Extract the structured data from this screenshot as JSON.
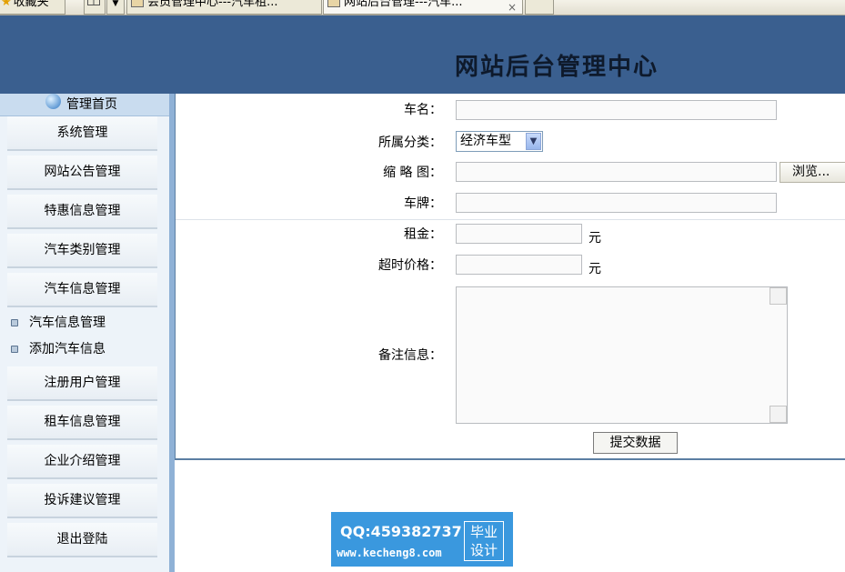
{
  "browser": {
    "favorites_label": "收藏夹",
    "tabs": [
      {
        "label": "会员管理中心---汽车租..."
      },
      {
        "label": "网站后台管理---汽车..."
      }
    ],
    "close_glyph": "×",
    "grid_icon": "grid-view-icon",
    "dropdown_icon": "chevron-down-icon"
  },
  "header": {
    "title": "网站后台管理中心",
    "bg_color": "#3a5f8f"
  },
  "sidebar": {
    "home_label": "管理首页",
    "items": [
      {
        "label": "系统管理"
      },
      {
        "label": "网站公告管理"
      },
      {
        "label": "特惠信息管理"
      },
      {
        "label": "汽车类别管理"
      },
      {
        "label": "汽车信息管理"
      }
    ],
    "sub_items": [
      {
        "label": "汽车信息管理"
      },
      {
        "label": "添加汽车信息"
      }
    ],
    "items_after": [
      {
        "label": "注册用户管理"
      },
      {
        "label": "租车信息管理"
      },
      {
        "label": "企业介绍管理"
      },
      {
        "label": "投诉建议管理"
      },
      {
        "label": "退出登陆"
      }
    ]
  },
  "form": {
    "car_name": {
      "label": "车名：",
      "value": ""
    },
    "category": {
      "label": "所属分类：",
      "selected": "经济车型"
    },
    "thumbnail": {
      "label": "缩 略 图：",
      "value": "",
      "browse_label": "浏览..."
    },
    "plate": {
      "label": "车牌：",
      "value": ""
    },
    "rent": {
      "label": "租金：",
      "value": "",
      "unit": "元"
    },
    "overtime_price": {
      "label": "超时价格：",
      "value": "",
      "unit": "元"
    },
    "remark": {
      "label": "备注信息：",
      "value": ""
    },
    "submit_label": "提交数据"
  },
  "watermark": {
    "qq": "QQ:459382737",
    "url": "www.kecheng8.com",
    "badge_line1": "毕业",
    "badge_line2": "设计"
  }
}
